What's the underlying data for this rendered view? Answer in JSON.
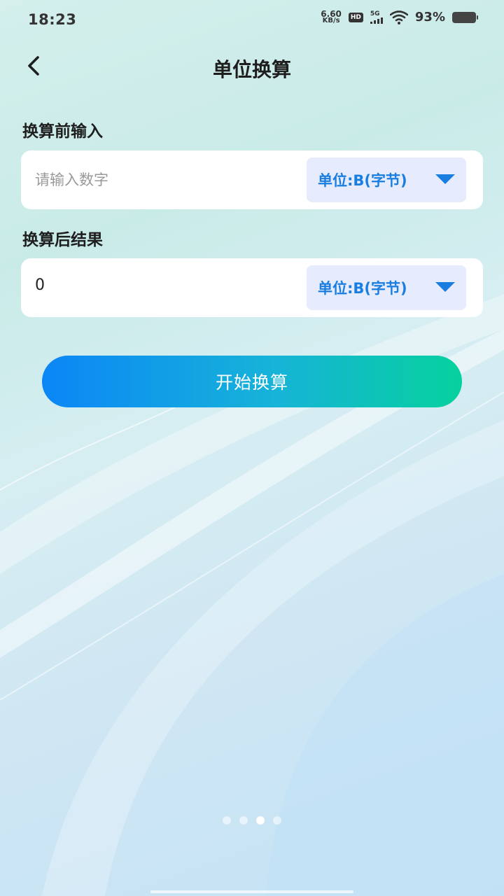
{
  "status_bar": {
    "time": "18:23",
    "net_speed_value": "6.60",
    "net_speed_unit": "KB/s",
    "hd_badge": "HD",
    "network_type": "5G",
    "battery_percent": "93%"
  },
  "header": {
    "title": "单位换算"
  },
  "input_section": {
    "label": "换算前输入",
    "placeholder": "请输入数字",
    "unit_label": "单位:B(字节)"
  },
  "result_section": {
    "label": "换算后结果",
    "value": "0",
    "unit_label": "单位:B(字节)"
  },
  "convert_button": {
    "label": "开始换算"
  },
  "pager": {
    "count": 4,
    "active_index": 2
  },
  "colors": {
    "accent_blue": "#1a7ee0",
    "unit_bg": "#e6ecfd",
    "button_gradient_start": "#0b86f7",
    "button_gradient_end": "#06d19e"
  }
}
